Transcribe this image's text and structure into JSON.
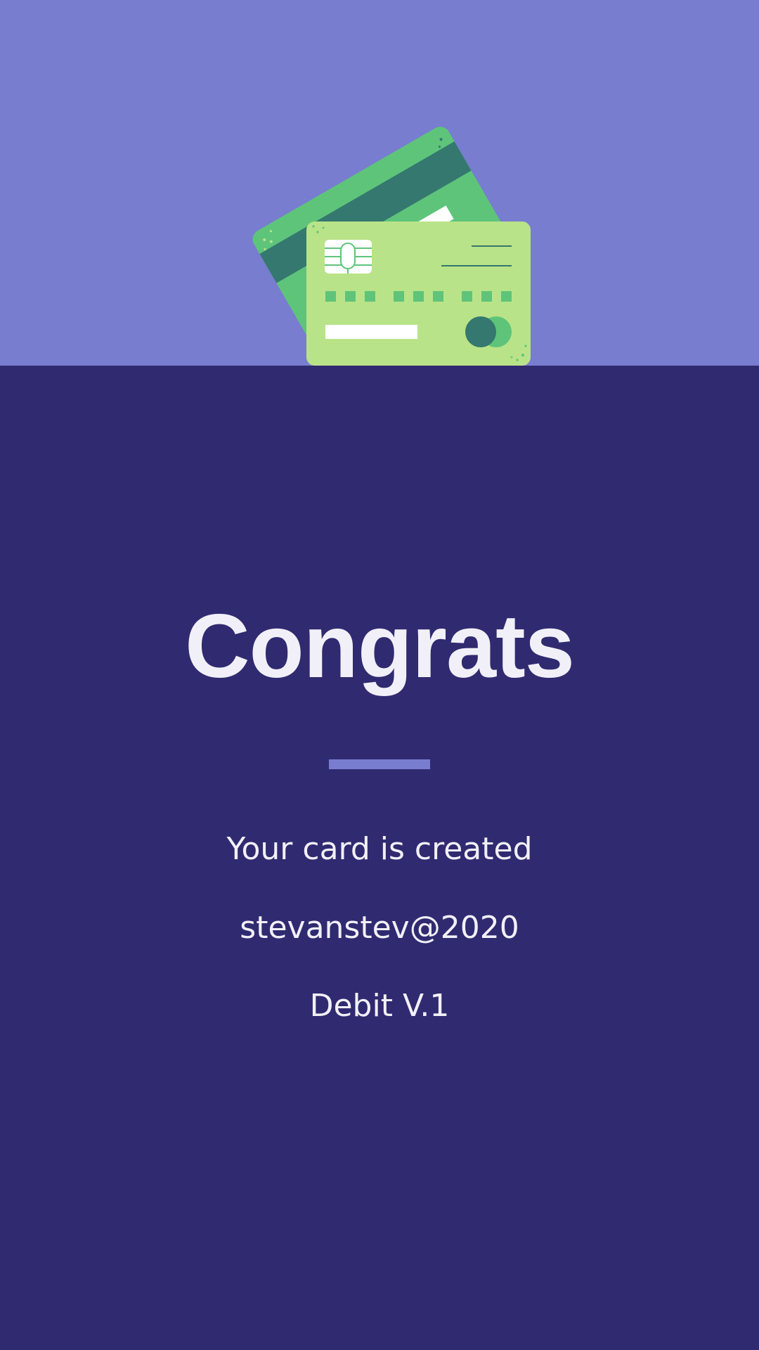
{
  "screen": {
    "title": "Congrats",
    "message": "Your card is created",
    "username": "stevanstev@2020",
    "card_type": "Debit V.1"
  },
  "colors": {
    "top_background": "#787dcf",
    "bottom_background": "#302a70",
    "text": "#f1f0f8",
    "accent": "#787dcf",
    "card_back": "#5ec47a",
    "card_front": "#b9e388",
    "card_dark": "#34786f"
  },
  "illustration": {
    "icon": "credit-cards-illustration"
  }
}
